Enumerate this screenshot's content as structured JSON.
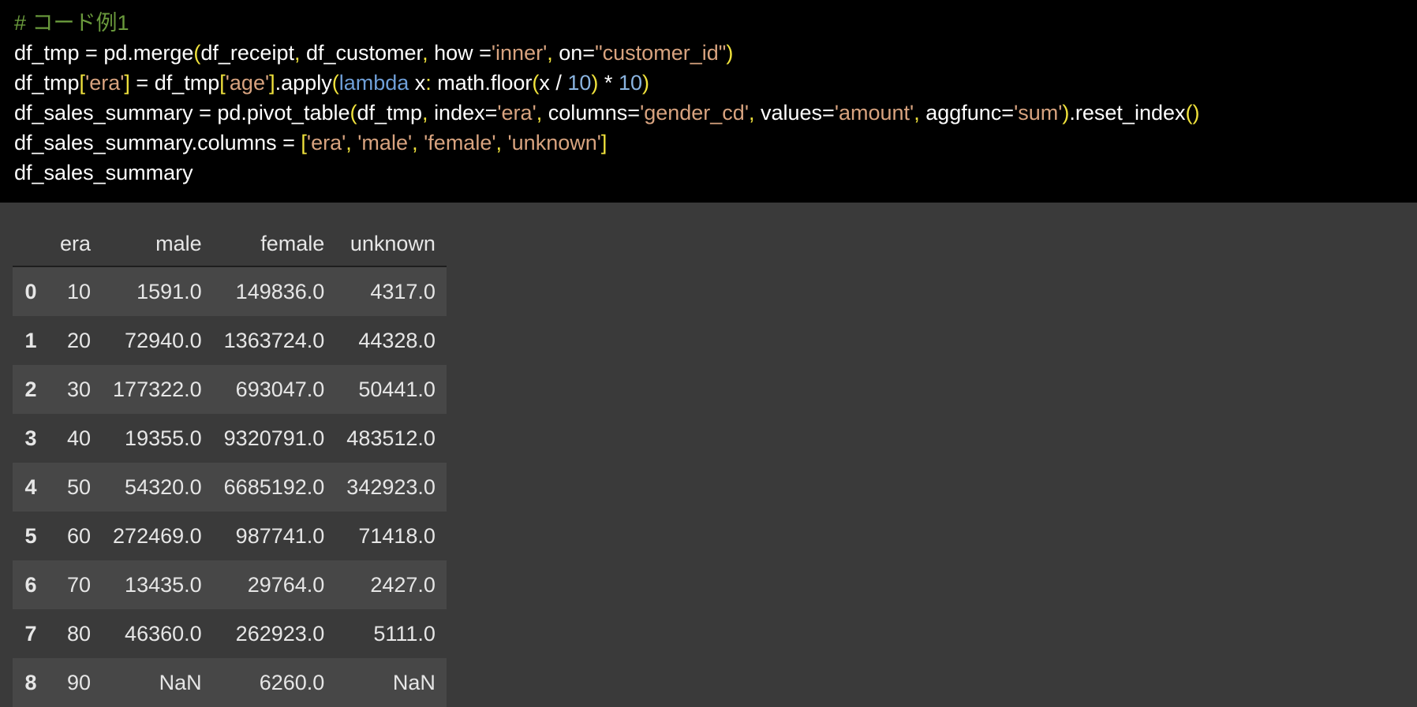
{
  "code_cell": {
    "lines": [
      [
        {
          "t": "# コード例1",
          "c": "comment"
        }
      ],
      [
        {
          "t": "df_tmp = pd.merge",
          "c": "plain"
        },
        {
          "t": "(",
          "c": "brk"
        },
        {
          "t": "df_receipt",
          "c": "plain"
        },
        {
          "t": ", ",
          "c": "brk"
        },
        {
          "t": "df_customer",
          "c": "plain"
        },
        {
          "t": ", ",
          "c": "brk"
        },
        {
          "t": "how =",
          "c": "plain"
        },
        {
          "t": "'inner'",
          "c": "str"
        },
        {
          "t": ", ",
          "c": "brk"
        },
        {
          "t": "on=",
          "c": "plain"
        },
        {
          "t": "\"customer_id\"",
          "c": "str"
        },
        {
          "t": ")",
          "c": "brk"
        }
      ],
      [
        {
          "t": "df_tmp",
          "c": "plain"
        },
        {
          "t": "[",
          "c": "brk"
        },
        {
          "t": "'era'",
          "c": "str"
        },
        {
          "t": "]",
          "c": "brk"
        },
        {
          "t": " = df_tmp",
          "c": "plain"
        },
        {
          "t": "[",
          "c": "brk"
        },
        {
          "t": "'age'",
          "c": "str"
        },
        {
          "t": "]",
          "c": "brk"
        },
        {
          "t": ".apply",
          "c": "plain"
        },
        {
          "t": "(",
          "c": "brk"
        },
        {
          "t": "lambda",
          "c": "kw"
        },
        {
          "t": " x",
          "c": "plain"
        },
        {
          "t": ":",
          "c": "brk"
        },
        {
          "t": " math.floor",
          "c": "plain"
        },
        {
          "t": "(",
          "c": "brk"
        },
        {
          "t": "x / ",
          "c": "plain"
        },
        {
          "t": "10",
          "c": "num"
        },
        {
          "t": ")",
          "c": "brk"
        },
        {
          "t": " * ",
          "c": "plain"
        },
        {
          "t": "10",
          "c": "num"
        },
        {
          "t": ")",
          "c": "brk"
        }
      ],
      [
        {
          "t": "df_sales_summary = pd.pivot_table",
          "c": "plain"
        },
        {
          "t": "(",
          "c": "brk"
        },
        {
          "t": "df_tmp",
          "c": "plain"
        },
        {
          "t": ", ",
          "c": "brk"
        },
        {
          "t": "index=",
          "c": "plain"
        },
        {
          "t": "'era'",
          "c": "str"
        },
        {
          "t": ", ",
          "c": "brk"
        },
        {
          "t": "columns=",
          "c": "plain"
        },
        {
          "t": "'gender_cd'",
          "c": "str"
        },
        {
          "t": ", ",
          "c": "brk"
        },
        {
          "t": "values=",
          "c": "plain"
        },
        {
          "t": "'amount'",
          "c": "str"
        },
        {
          "t": ", ",
          "c": "brk"
        },
        {
          "t": "aggfunc=",
          "c": "plain"
        },
        {
          "t": "'sum'",
          "c": "str"
        },
        {
          "t": ")",
          "c": "brk"
        },
        {
          "t": ".reset_index",
          "c": "plain"
        },
        {
          "t": "()",
          "c": "brk"
        }
      ],
      [
        {
          "t": "df_sales_summary.columns = ",
          "c": "plain"
        },
        {
          "t": "[",
          "c": "brk"
        },
        {
          "t": "'era'",
          "c": "str"
        },
        {
          "t": ", ",
          "c": "brk"
        },
        {
          "t": "'male'",
          "c": "str"
        },
        {
          "t": ", ",
          "c": "brk"
        },
        {
          "t": "'female'",
          "c": "str"
        },
        {
          "t": ", ",
          "c": "brk"
        },
        {
          "t": "'unknown'",
          "c": "str"
        },
        {
          "t": "]",
          "c": "brk"
        }
      ],
      [
        {
          "t": "df_sales_summary",
          "c": "plain"
        }
      ]
    ]
  },
  "output": {
    "headers": [
      "",
      "era",
      "male",
      "female",
      "unknown"
    ],
    "rows": [
      {
        "index": "0",
        "cells": [
          "10",
          "1591.0",
          "149836.0",
          "4317.0"
        ]
      },
      {
        "index": "1",
        "cells": [
          "20",
          "72940.0",
          "1363724.0",
          "44328.0"
        ]
      },
      {
        "index": "2",
        "cells": [
          "30",
          "177322.0",
          "693047.0",
          "50441.0"
        ]
      },
      {
        "index": "3",
        "cells": [
          "40",
          "19355.0",
          "9320791.0",
          "483512.0"
        ]
      },
      {
        "index": "4",
        "cells": [
          "50",
          "54320.0",
          "6685192.0",
          "342923.0"
        ]
      },
      {
        "index": "5",
        "cells": [
          "60",
          "272469.0",
          "987741.0",
          "71418.0"
        ]
      },
      {
        "index": "6",
        "cells": [
          "70",
          "13435.0",
          "29764.0",
          "2427.0"
        ]
      },
      {
        "index": "7",
        "cells": [
          "80",
          "46360.0",
          "262923.0",
          "5111.0"
        ]
      },
      {
        "index": "8",
        "cells": [
          "90",
          "NaN",
          "6260.0",
          "NaN"
        ]
      }
    ]
  },
  "colors": {
    "code_bg": "#000000",
    "output_bg": "#3a3a3a",
    "row_stripe": "#474747",
    "comment": "#6a9a3c",
    "string": "#d8a37f",
    "bracket": "#f0e23c",
    "keyword": "#6f9fd8",
    "number": "#8ab4e0"
  }
}
